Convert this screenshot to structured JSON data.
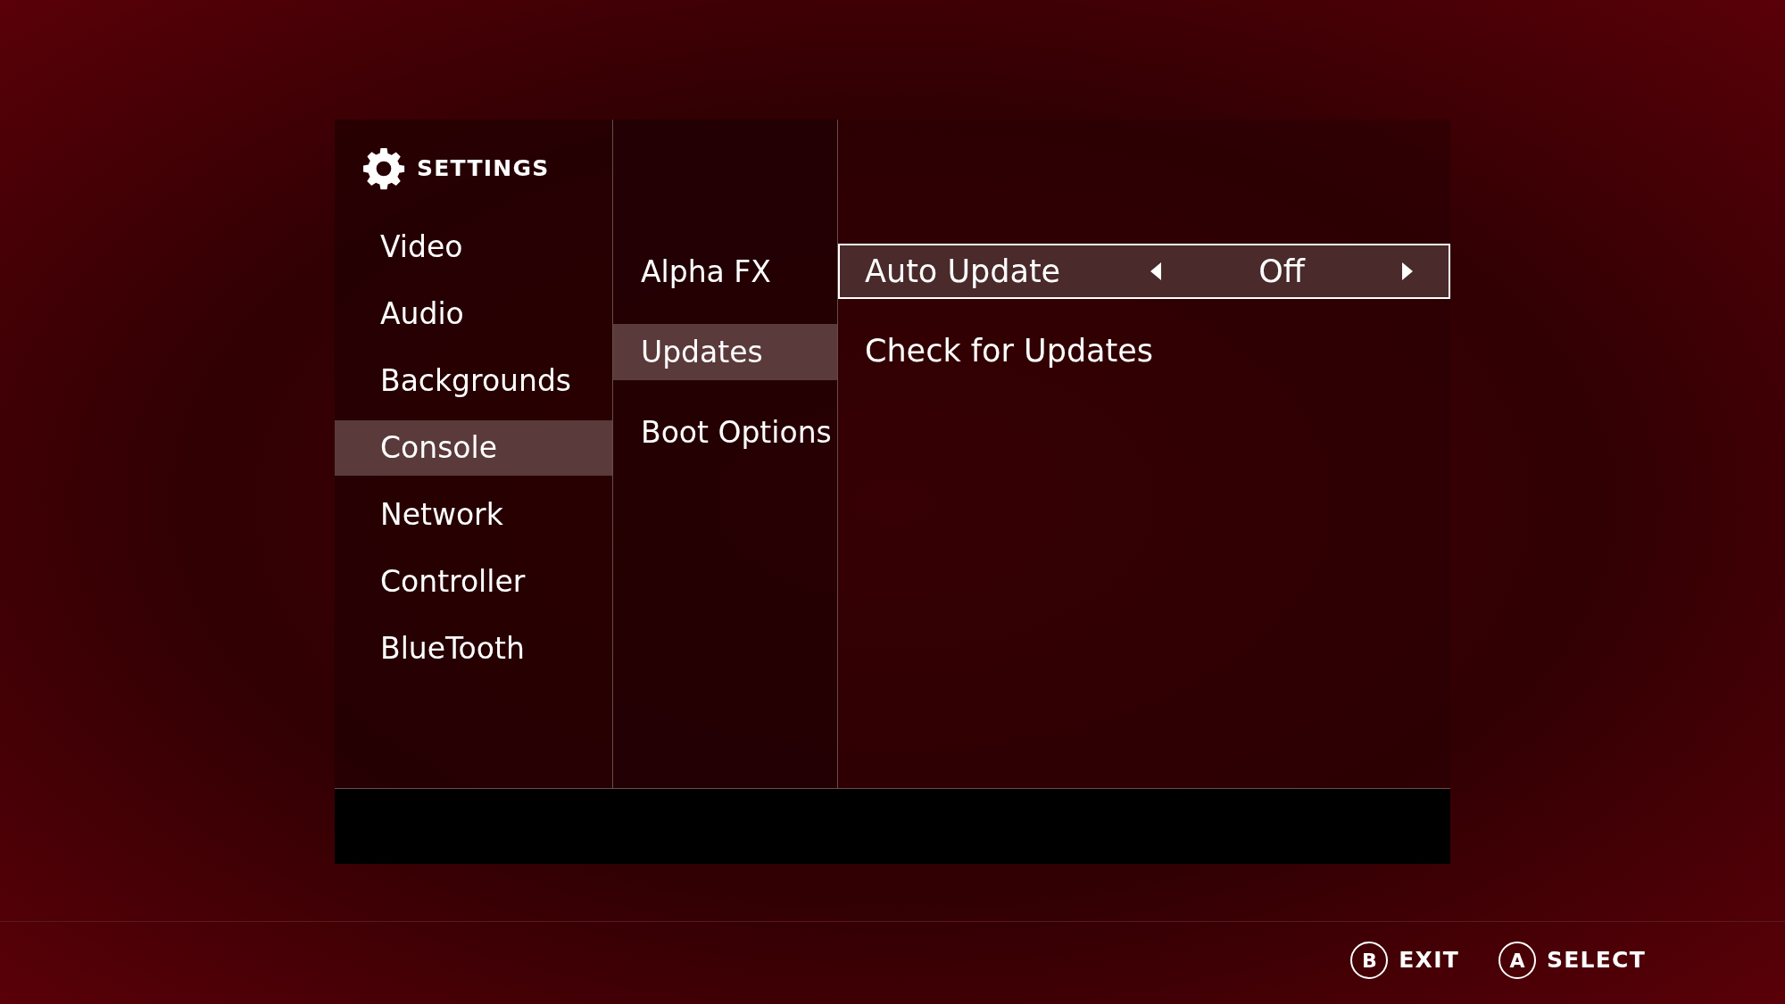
{
  "header": {
    "title": "SETTINGS"
  },
  "categories": [
    {
      "label": "Video",
      "selected": false
    },
    {
      "label": "Audio",
      "selected": false
    },
    {
      "label": "Backgrounds",
      "selected": false
    },
    {
      "label": "Console",
      "selected": true
    },
    {
      "label": "Network",
      "selected": false
    },
    {
      "label": "Controller",
      "selected": false
    },
    {
      "label": "BlueTooth",
      "selected": false
    }
  ],
  "subcategories": [
    {
      "label": "Alpha FX",
      "selected": false
    },
    {
      "label": "Updates",
      "selected": true
    },
    {
      "label": "Boot Options",
      "selected": false
    }
  ],
  "options": [
    {
      "kind": "selector",
      "label": "Auto Update",
      "value": "Off",
      "selected": true
    },
    {
      "kind": "action",
      "label": "Check for Updates",
      "selected": false
    }
  ],
  "footer_buttons": [
    {
      "key": "B",
      "label": "EXIT"
    },
    {
      "key": "A",
      "label": "SELECT"
    }
  ]
}
